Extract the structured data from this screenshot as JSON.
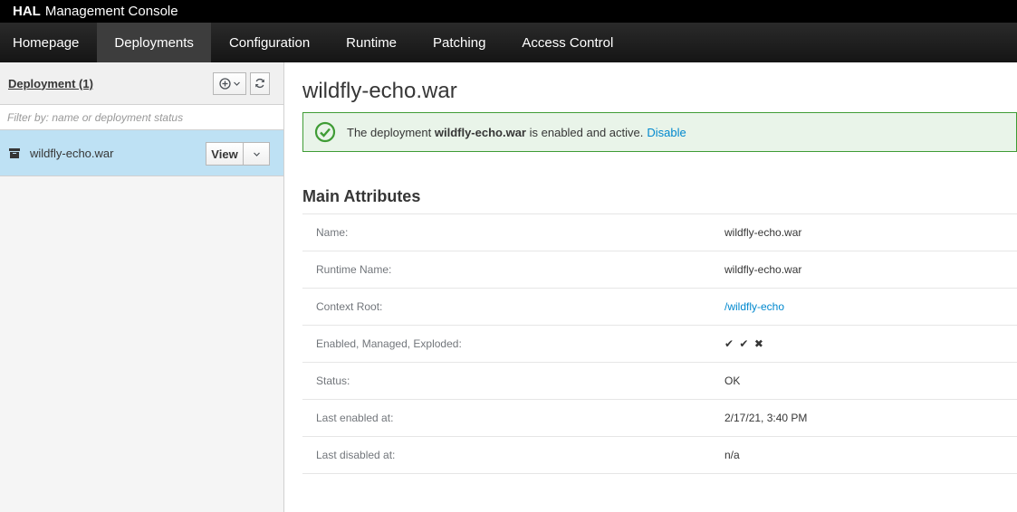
{
  "brand": {
    "bold": "HAL",
    "rest": "Management Console"
  },
  "nav": {
    "items": [
      {
        "label": "Homepage"
      },
      {
        "label": "Deployments"
      },
      {
        "label": "Configuration"
      },
      {
        "label": "Runtime"
      },
      {
        "label": "Patching"
      },
      {
        "label": "Access Control"
      }
    ],
    "active": "Deployments"
  },
  "sidebar": {
    "title": "Deployment (1)",
    "filter_placeholder": "Filter by: name or deployment status",
    "items": [
      {
        "name": "wildfly-echo.war",
        "action": "View"
      }
    ]
  },
  "main": {
    "title": "wildfly-echo.war",
    "alert": {
      "prefix": "The deployment",
      "name": "wildfly-echo.war",
      "suffix": "is enabled and active.",
      "link": "Disable"
    },
    "section_title": "Main Attributes",
    "attributes": [
      {
        "label": "Name:",
        "value": "wildfly-echo.war"
      },
      {
        "label": "Runtime Name:",
        "value": "wildfly-echo.war"
      },
      {
        "label": "Context Root:",
        "value": "/wildfly-echo"
      },
      {
        "label": "Enabled, Managed, Exploded:",
        "value": [
          "✔",
          "✔",
          "✖"
        ]
      },
      {
        "label": "Status:",
        "value": "OK"
      },
      {
        "label": "Last enabled at:",
        "value": "2/17/21, 3:40 PM"
      },
      {
        "label": "Last disabled at:",
        "value": "n/a"
      }
    ]
  },
  "colors": {
    "selected_row": "#bee1f4",
    "alert_border": "#3f9c35",
    "link": "#0088ce"
  },
  "icons": [
    "add-circle-icon",
    "chevron-down-icon",
    "refresh-icon",
    "archive-icon",
    "check-circle-icon",
    "check-icon",
    "times-icon"
  ]
}
